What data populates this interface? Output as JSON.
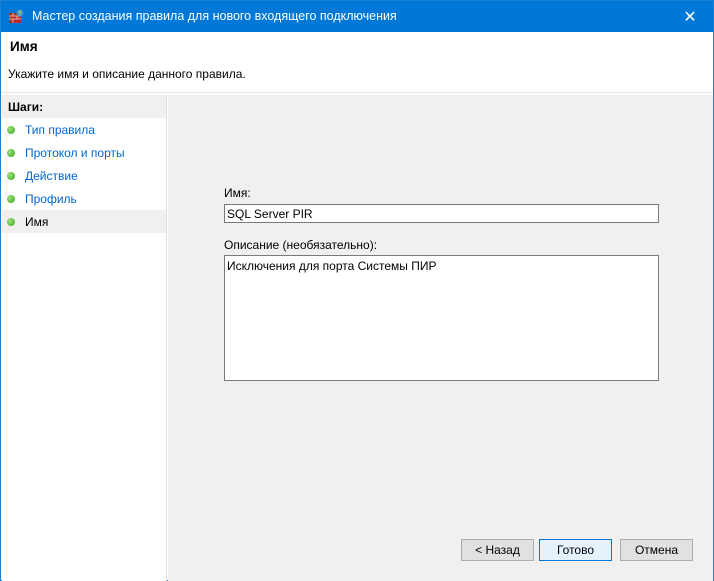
{
  "window": {
    "title": "Мастер создания правила для нового входящего подключения",
    "close": "✕"
  },
  "header": {
    "title": "Имя",
    "subtitle": "Укажите имя и описание данного правила."
  },
  "steps": {
    "heading": "Шаги:",
    "items": [
      {
        "label": "Тип правила"
      },
      {
        "label": "Протокол и порты"
      },
      {
        "label": "Действие"
      },
      {
        "label": "Профиль"
      },
      {
        "label": "Имя"
      }
    ]
  },
  "form": {
    "name_label": "Имя:",
    "name_value": "SQL Server PIR",
    "desc_label": "Описание (необязательно):",
    "desc_value": "Исключения для порта Системы ПИР"
  },
  "buttons": {
    "back": "< Назад",
    "finish": "Готово",
    "cancel": "Отмена"
  }
}
